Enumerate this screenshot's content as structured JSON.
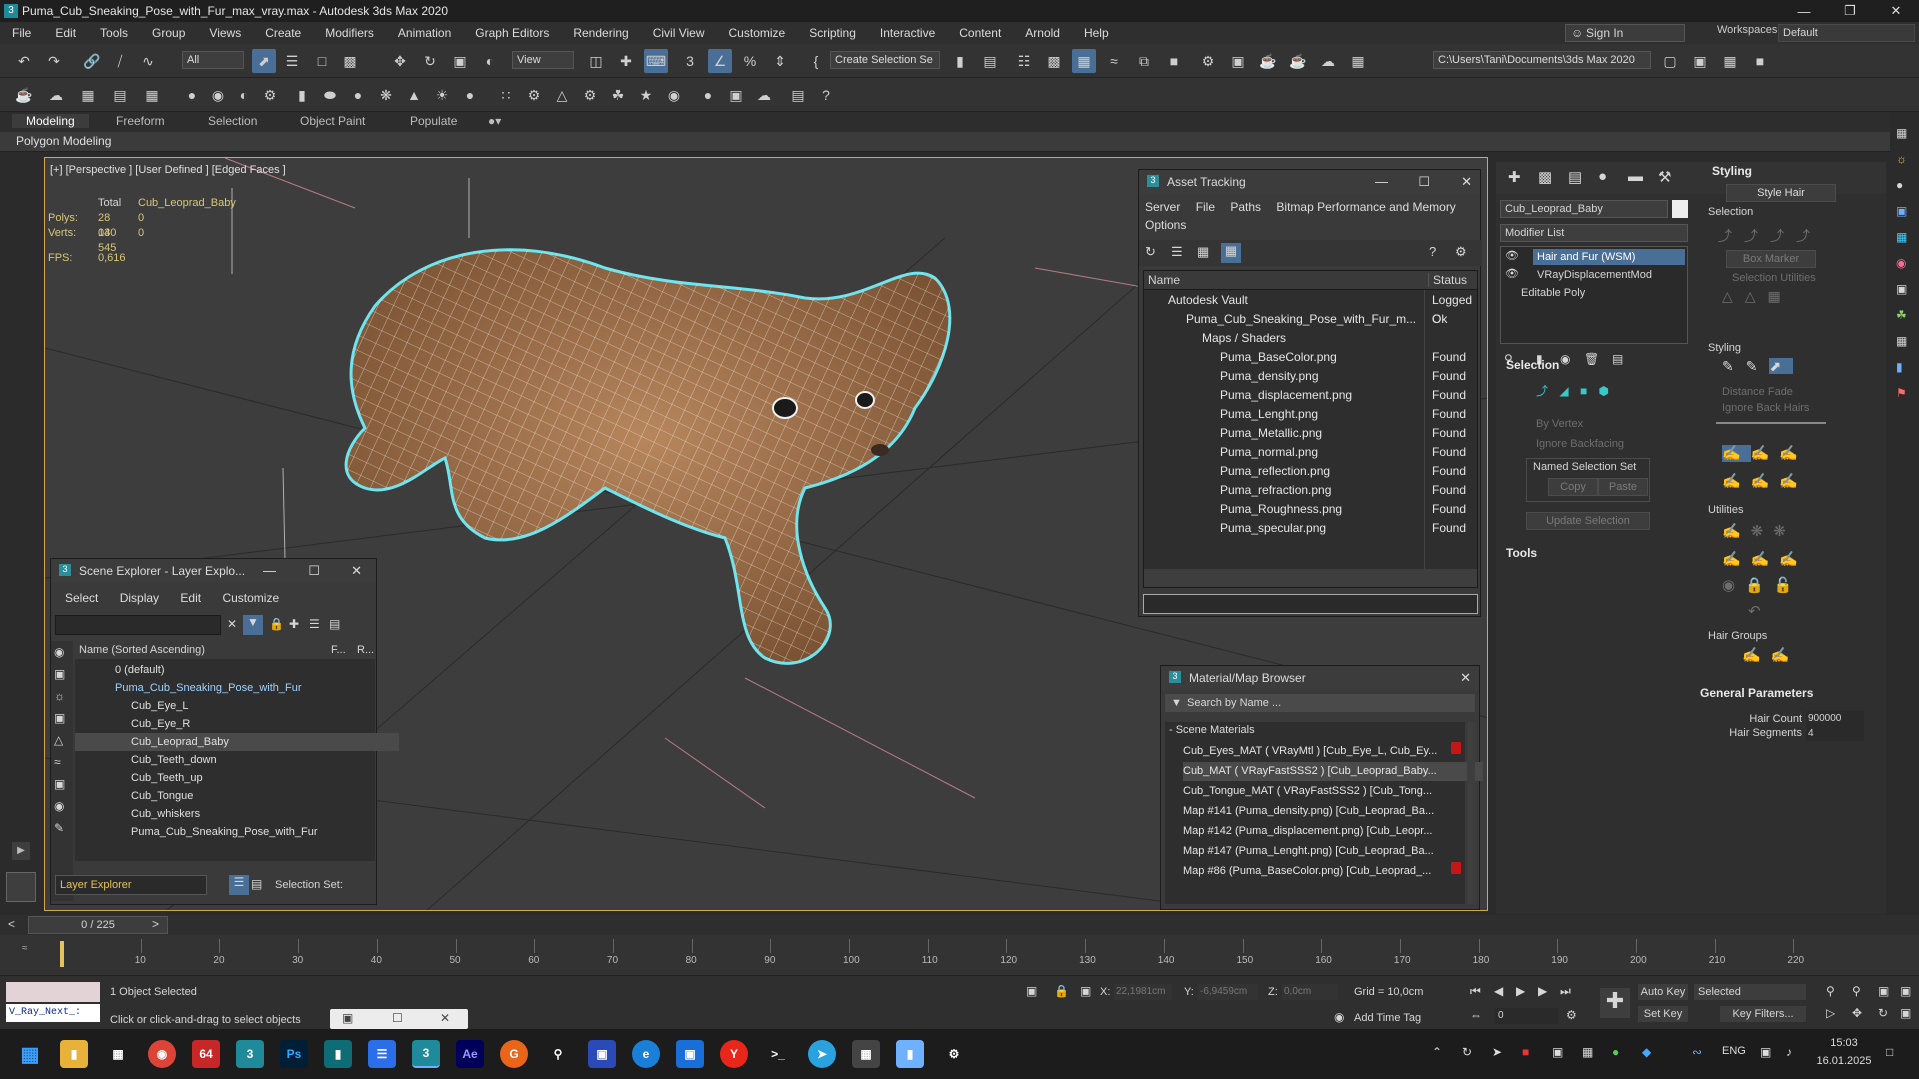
{
  "title_bar": {
    "title": "Puma_Cub_Sneaking_Pose_with_Fur_max_vray.max - Autodesk 3ds Max 2020"
  },
  "menu": [
    "File",
    "Edit",
    "Tools",
    "Group",
    "Views",
    "Create",
    "Modifiers",
    "Animation",
    "Graph Editors",
    "Rendering",
    "Civil View",
    "Customize",
    "Scripting",
    "Interactive",
    "Content",
    "Arnold",
    "Help"
  ],
  "account": {
    "sign_in": "Sign In",
    "workspaces_label": "Workspaces:",
    "workspace": "Default"
  },
  "toolbar": {
    "filter": "All",
    "ref_coord": "View",
    "selection_set": "Create Selection Se",
    "project_path": "C:\\Users\\Tani\\Documents\\3ds Max 2020"
  },
  "ribbon": {
    "tabs": [
      "Modeling",
      "Freeform",
      "Selection",
      "Object Paint",
      "Populate"
    ],
    "sub": "Polygon Modeling"
  },
  "viewport": {
    "label": "[+] [Perspective ] [User Defined ] [Edged Faces ]",
    "stats": {
      "total_label": "Total",
      "object": "Cub_Leoprad_Baby",
      "polys_label": "Polys:",
      "polys_total": "28 030",
      "polys_obj": "0",
      "verts_label": "Verts:",
      "verts_total": "14 545",
      "verts_obj": "0",
      "fps_label": "FPS:",
      "fps": "0,616"
    }
  },
  "asset_tracking": {
    "title": "Asset Tracking",
    "menu": [
      "Server",
      "File",
      "Paths",
      "Bitmap Performance and Memory",
      "Options"
    ],
    "col_name": "Name",
    "col_status": "Status",
    "rows": [
      {
        "name": "Autodesk Vault",
        "status": "Logged O"
      },
      {
        "name": "Puma_Cub_Sneaking_Pose_with_Fur_m...",
        "status": "Ok"
      },
      {
        "name": "Maps / Shaders",
        "status": ""
      },
      {
        "name": "Puma_BaseColor.png",
        "status": "Found"
      },
      {
        "name": "Puma_density.png",
        "status": "Found"
      },
      {
        "name": "Puma_displacement.png",
        "status": "Found"
      },
      {
        "name": "Puma_Lenght.png",
        "status": "Found"
      },
      {
        "name": "Puma_Metallic.png",
        "status": "Found"
      },
      {
        "name": "Puma_normal.png",
        "status": "Found"
      },
      {
        "name": "Puma_reflection.png",
        "status": "Found"
      },
      {
        "name": "Puma_refraction.png",
        "status": "Found"
      },
      {
        "name": "Puma_Roughness.png",
        "status": "Found"
      },
      {
        "name": "Puma_specular.png",
        "status": "Found"
      }
    ]
  },
  "scene_explorer": {
    "title": "Scene Explorer - Layer Explo...",
    "menu": [
      "Select",
      "Display",
      "Edit",
      "Customize"
    ],
    "header": "Name (Sorted Ascending)",
    "col_f": "F...",
    "col_r": "R...",
    "rows": [
      "0 (default)",
      "Puma_Cub_Sneaking_Pose_with_Fur",
      "Cub_Eye_L",
      "Cub_Eye_R",
      "Cub_Leoprad_Baby",
      "Cub_Teeth_down",
      "Cub_Teeth_up",
      "Cub_Tongue",
      "Cub_whiskers",
      "Puma_Cub_Sneaking_Pose_with_Fur"
    ],
    "footer_explorer": "Layer Explorer",
    "footer_sel": "Selection Set:"
  },
  "material_browser": {
    "title": "Material/Map Browser",
    "search": "Search by Name ...",
    "section": "- Scene Materials",
    "rows": [
      "Cub_Eyes_MAT ( VRayMtl ) [Cub_Eye_L, Cub_Ey...",
      "Cub_MAT ( VRayFastSSS2 ) [Cub_Leoprad_Baby...",
      "Cub_Tongue_MAT ( VRayFastSSS2 ) [Cub_Tong...",
      "Map #141 (Puma_density.png) [Cub_Leoprad_Ba...",
      "Map #142 (Puma_displacement.png) [Cub_Leopr...",
      "Map #147 (Puma_Lenght.png) [Cub_Leoprad_Ba...",
      "Map #86 (Puma_BaseColor.png) [Cub_Leoprad_..."
    ]
  },
  "command_panel": {
    "object_name": "Cub_Leoprad_Baby",
    "modifier_list": "Modifier List",
    "stack": [
      "Hair and Fur (WSM)",
      "VRayDisplacementMod",
      "Editable Poly"
    ],
    "selection": {
      "title": "Selection",
      "by_vertex": "By Vertex",
      "ignore_backfacing": "Ignore Backfacing",
      "named_set": "Named Selection Set",
      "copy": "Copy",
      "paste": "Paste",
      "update": "Update Selection"
    },
    "tools": "Tools",
    "styling": {
      "title": "Styling",
      "style_hair": "Style Hair",
      "selection": "Selection",
      "box_marker": "Box Marker",
      "sel_utils": "Selection Utilities",
      "styling2": "Styling",
      "distance_fade": "Distance Fade",
      "ignore_back": "Ignore Back Hairs",
      "utilities": "Utilities",
      "hair_groups": "Hair Groups"
    },
    "general": {
      "title": "General Parameters",
      "hair_count_label": "Hair Count",
      "hair_count": "900000",
      "hair_segments_label": "Hair Segments",
      "hair_segments": "4"
    }
  },
  "timeline": {
    "frame": "0 / 225",
    "ticks": [
      "10",
      "20",
      "30",
      "40",
      "50",
      "60",
      "70",
      "80",
      "90",
      "100",
      "110",
      "120",
      "130",
      "140",
      "150",
      "160",
      "170",
      "180",
      "190",
      "200",
      "210",
      "220"
    ]
  },
  "status": {
    "script": "V_Ray_Next_:",
    "selected": "1 Object Selected",
    "hint": "Click or click-and-drag to select objects",
    "x_label": "X:",
    "x": "22,1981cm",
    "y_label": "Y:",
    "y": "-6,9459cm",
    "z_label": "Z:",
    "z": "0,0cm",
    "grid": "Grid = 10,0cm",
    "add_time_tag": "Add Time Tag",
    "auto_key": "Auto Key",
    "set_key": "Set Key",
    "selected_dd": "Selected",
    "key_filters": "Key Filters...",
    "frame_val": "0"
  },
  "taskbar": {
    "lang": "ENG",
    "time": "15:03",
    "date": "16.01.2025"
  }
}
